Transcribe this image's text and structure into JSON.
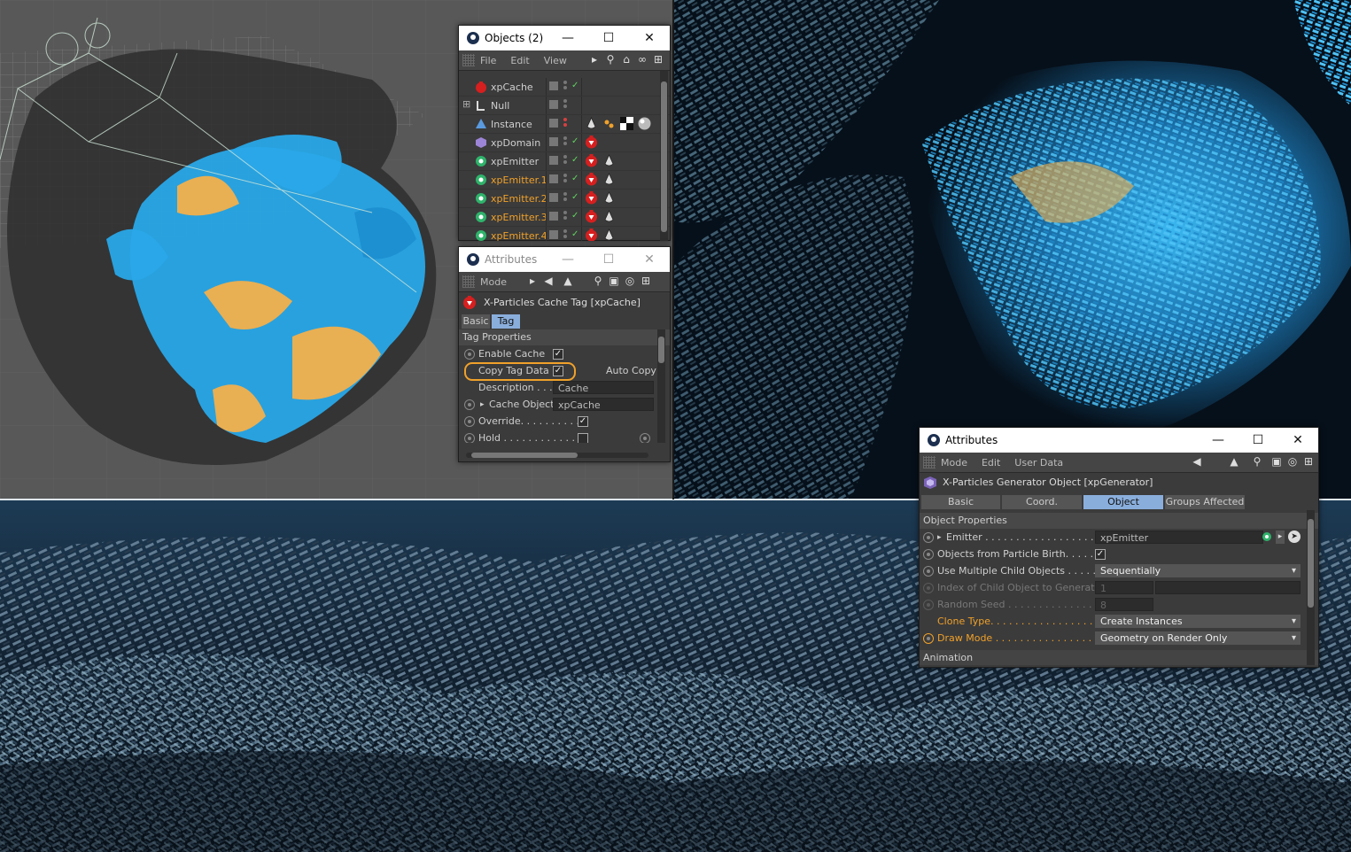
{
  "colors": {
    "accent_orange": "#f0a12a",
    "active_tab": "#8aaedc",
    "particle_blue": "#29a8e8",
    "particle_orange": "#f3b04b"
  },
  "objects_window": {
    "title": "Objects (2)",
    "menu": [
      "File",
      "Edit",
      "View"
    ],
    "objects": [
      {
        "name": "xpCache",
        "icon": "xp-cache-icon",
        "highlight": false
      },
      {
        "name": "Null",
        "icon": "null-object-icon",
        "highlight": false
      },
      {
        "name": "Instance",
        "icon": "instance-icon",
        "highlight": false
      },
      {
        "name": "xpDomain",
        "icon": "xp-domain-icon",
        "highlight": false
      },
      {
        "name": "xpEmitter",
        "icon": "xp-emitter-icon",
        "highlight": false
      },
      {
        "name": "xpEmitter.1",
        "icon": "xp-emitter-icon",
        "highlight": true
      },
      {
        "name": "xpEmitter.2",
        "icon": "xp-emitter-icon",
        "highlight": true
      },
      {
        "name": "xpEmitter.3",
        "icon": "xp-emitter-icon",
        "highlight": true
      },
      {
        "name": "xpEmitter.4",
        "icon": "xp-emitter-icon",
        "highlight": true
      }
    ]
  },
  "attr_window_1": {
    "title": "Attributes",
    "mode_label": "Mode",
    "header": "X-Particles Cache Tag [xpCache]",
    "tabs": [
      "Basic",
      "Tag"
    ],
    "active_tab": "Tag",
    "section": "Tag Properties",
    "enable_cache": "Enable Cache",
    "copy_tag_data": "Copy Tag Data",
    "auto_copy": "Auto Copy",
    "description_label": "Description . . .",
    "description_value": "Cache",
    "cache_object_label": "Cache Object",
    "cache_object_value": "xpCache",
    "override": "Override. . . . . . . . . .",
    "hold": "Hold . . . . . . . . . . . . . ."
  },
  "attr_window_2": {
    "title": "Attributes",
    "menu": [
      "Mode",
      "Edit",
      "User Data"
    ],
    "header": "X-Particles Generator Object [xpGenerator]",
    "tabs": [
      "Basic",
      "Coord.",
      "Object",
      "Groups Affected"
    ],
    "active_tab": "Object",
    "section": "Object Properties",
    "emitter_label": "Emitter . . . . . . . . . . . . . . . . . .",
    "emitter_value": "xpEmitter",
    "objects_from_birth": "Objects from Particle Birth. . . . . . .",
    "use_multiple": "Use Multiple Child Objects . . . . . .",
    "use_multiple_value": "Sequentially",
    "index_child": "Index of Child Object to Generate",
    "index_child_value": "1",
    "random_seed": "Random Seed . . . . . . . . . . . . . . .",
    "random_seed_value": "8",
    "clone_type": "Clone Type. . . . . . . . . . . . . . . . . .",
    "clone_type_value": "Create Instances",
    "draw_mode": "Draw Mode . . . . . . . . . . . . . . . . .",
    "draw_mode_value": "Geometry on Render Only",
    "next_section": "Animation"
  }
}
